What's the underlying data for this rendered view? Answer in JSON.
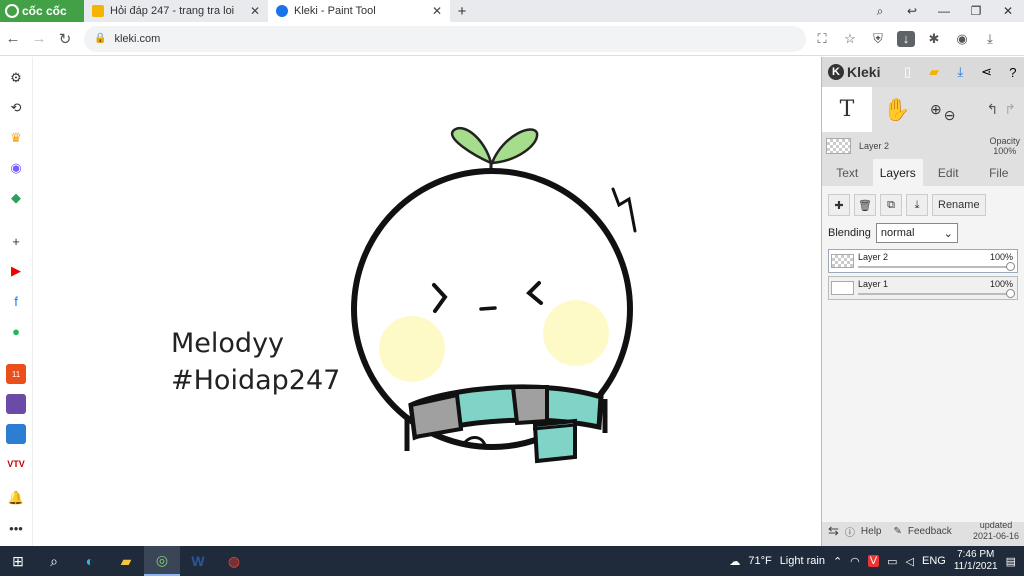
{
  "browser": {
    "brand": "cốc cốc",
    "tabs": [
      {
        "label": "Hỏi đáp 247 - trang tra loi",
        "favicon_color": "#f4b400"
      },
      {
        "label": "Kleki - Paint Tool",
        "favicon_color": "#1a73e8"
      }
    ],
    "url": "kleki.com"
  },
  "canvas": {
    "text_line1": "Melodyy",
    "text_line2": "#Hoidap247"
  },
  "kleki": {
    "logo": "Kleki",
    "active_layer": "Layer 2",
    "opacity_label": "Opacity",
    "opacity_value": "100%",
    "tabs": [
      "Text",
      "Layers",
      "Edit",
      "File"
    ],
    "active_tab": "Layers",
    "rename_label": "Rename",
    "blending_label": "Blending",
    "blending_value": "normal",
    "layers": [
      {
        "name": "Layer 2",
        "opacity": "100%",
        "selected": true
      },
      {
        "name": "Layer 1",
        "opacity": "100%",
        "selected": false
      }
    ],
    "help_label": "Help",
    "feedback_label": "Feedback",
    "updated_label": "updated",
    "updated_date": "2021-06-16"
  },
  "taskbar": {
    "weather_temp": "71°F",
    "weather_desc": "Light rain",
    "language": "ENG",
    "time": "7:46 PM",
    "date": "11/1/2021"
  },
  "colors": {
    "brand_green": "#42a047",
    "sprout_green": "#a6dd8c",
    "cheek_yellow": "#fdfac8",
    "scarf_teal": "#7fd3c7",
    "scarf_gray": "#a0a0a0"
  }
}
